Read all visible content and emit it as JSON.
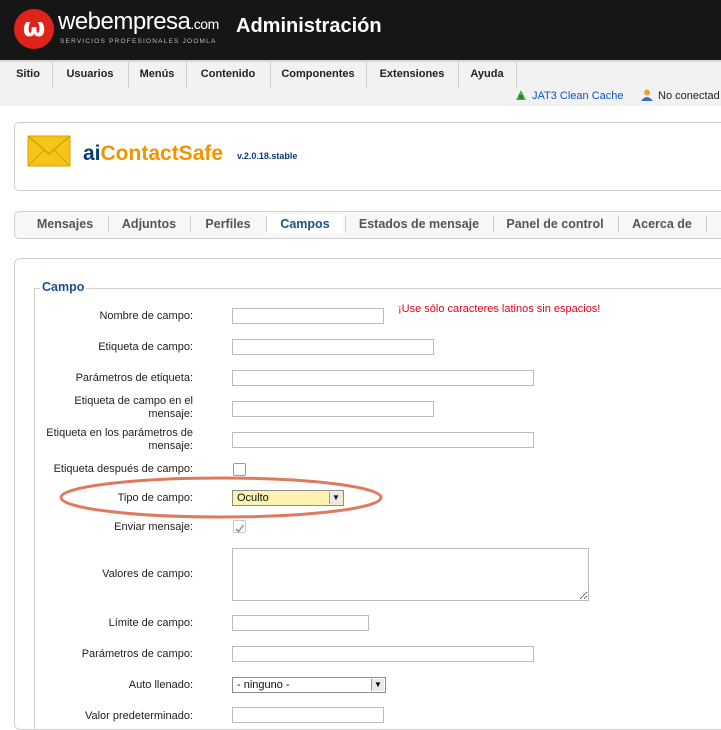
{
  "header": {
    "logo_glyph": "ω",
    "brand": "webempresa",
    "brand_suffix": ".com",
    "brand_subtitle": "SERVICIOS PROFESIONALES JOOMLA",
    "title": "Administración",
    "colors": {
      "bar": "#161616",
      "logo": "#e0231a"
    }
  },
  "menu": {
    "items": [
      "Sitio",
      "Usuarios",
      "Menús",
      "Contenido",
      "Componentes",
      "Extensiones",
      "Ayuda"
    ]
  },
  "toolbar": {
    "cache_label": "JAT3 Clean Cache",
    "user_status": "No conectad"
  },
  "component": {
    "title_prefix": "ai",
    "title_main": "ContactSafe",
    "version": "v.2.0.18.stable",
    "icon": "envelope-icon"
  },
  "tabs": {
    "items": [
      "Mensajes",
      "Adjuntos",
      "Perfiles",
      "Campos",
      "Estados de mensaje",
      "Panel de control",
      "Acerca de"
    ],
    "active": "Campos"
  },
  "form": {
    "legend": "Campo",
    "warning": "¡Use sólo caracteres latinos sin espacios!",
    "labels": {
      "field_name": "Nombre de campo:",
      "field_label": "Etiqueta de campo:",
      "label_params": "Parámetros de etiqueta:",
      "msg_label_1": "Etiqueta de campo en el",
      "msg_label_2": "mensaje:",
      "msg_label_params_1": "Etiqueta en los parámetros de",
      "msg_label_params_2": "mensaje:",
      "label_after": "Etiqueta después de campo:",
      "field_type": "Tipo de campo:",
      "send_message": "Enviar mensaje:",
      "field_values": "Valores de campo:",
      "field_limit": "Límite de campo:",
      "field_params": "Parámetros de campo:",
      "autofill": "Auto llenado:",
      "default_value": "Valor predeterminado:"
    },
    "values": {
      "field_type": "Oculto",
      "autofill": "- ninguno -",
      "label_after_checked": false,
      "send_message_checked": true
    },
    "highlight_color": "#e07a5f"
  }
}
